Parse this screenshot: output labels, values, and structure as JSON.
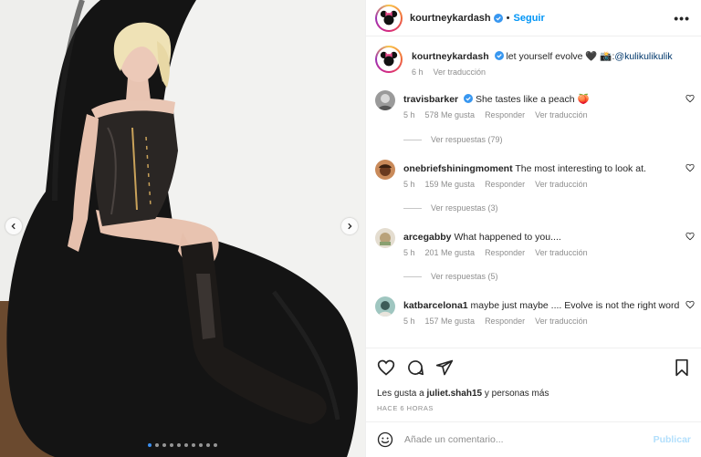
{
  "post": {
    "username": "kourtneykardash",
    "separator": "•",
    "follow_label": "Seguir",
    "more_label": "•••",
    "caption": {
      "text": "let yourself evolve 🖤 📸:",
      "tag": "@kulikulikulik",
      "time": "6 h",
      "translate": "Ver traducción"
    },
    "carousel": {
      "total": 10,
      "active_index": 0
    }
  },
  "comments": [
    {
      "username": "travisbarker",
      "verified": true,
      "text": "She tastes like a peach 🍑",
      "time": "5 h",
      "likes": "578 Me gusta",
      "reply": "Responder",
      "translate": "Ver traducción",
      "replies_label": "Ver respuestas (79)"
    },
    {
      "username": "onebriefshiningmoment",
      "verified": false,
      "text": "The most interesting to look at.",
      "time": "5 h",
      "likes": "159 Me gusta",
      "reply": "Responder",
      "translate": "Ver traducción",
      "replies_label": "Ver respuestas (3)"
    },
    {
      "username": "arcegabby",
      "verified": false,
      "text": "What happened to you....",
      "time": "5 h",
      "likes": "201 Me gusta",
      "reply": "Responder",
      "translate": "Ver traducción",
      "replies_label": "Ver respuestas (5)"
    },
    {
      "username": "katbarcelona1",
      "verified": false,
      "text": "maybe just maybe .... Evolve is not the right word",
      "time": "5 h",
      "likes": "157 Me gusta",
      "reply": "Responder",
      "translate": "Ver traducción"
    }
  ],
  "actions": {
    "icons": [
      "heart-icon",
      "comment-icon",
      "share-icon",
      "bookmark-icon"
    ],
    "likes_prefix": "Les gusta a",
    "likes_user": "juliet.shah15",
    "likes_suffix": "y personas más",
    "time_ago": "HACE 6 HORAS"
  },
  "add_comment": {
    "placeholder": "Añade un comentario...",
    "publish_label": "Publicar"
  },
  "colors": {
    "link_blue": "#0095f6",
    "publish_disabled": "#b2dffc",
    "secondary_text": "#8e8e8e",
    "verified": "#3897f0"
  }
}
